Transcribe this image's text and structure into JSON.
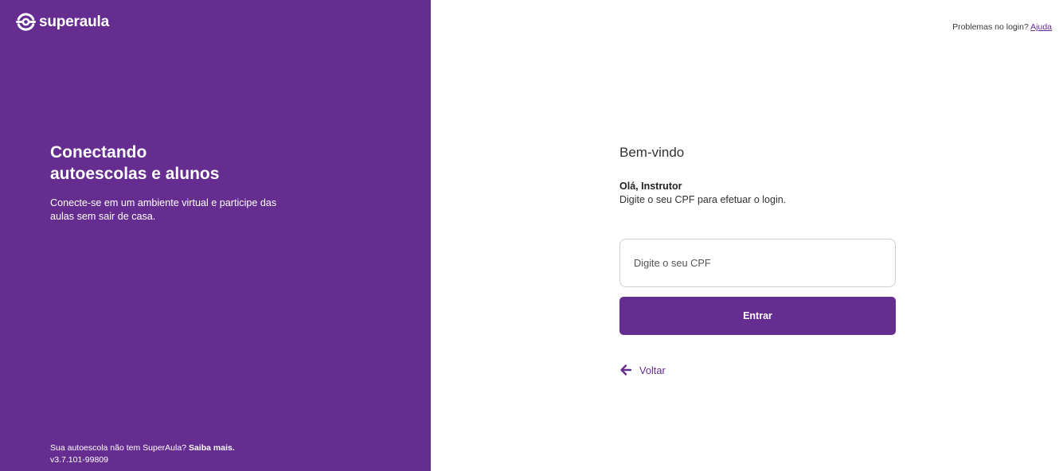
{
  "brand": {
    "name": "superaula",
    "logo_icon": "superaula-logo-icon",
    "primary_color": "#652d8f"
  },
  "left_panel": {
    "headline_line1": "Conectando",
    "headline_line2": "autoescolas e alunos",
    "description": "Conecte-se em um ambiente virtual e participe das aulas sem sair de casa.",
    "footer_text": "Sua autoescola não tem SuperAula?",
    "footer_link": "Saiba mais.",
    "version": "v3.7.101-99809"
  },
  "header": {
    "help_text": "Problemas no login?",
    "help_link": "Ajuda"
  },
  "login": {
    "title": "Bem-vindo",
    "greeting": "Olá, Instrutor",
    "instruction": "Digite o seu CPF para efetuar o login.",
    "cpf_placeholder": "Digite o seu CPF",
    "cpf_value": "",
    "submit_label": "Entrar",
    "back_label": "Voltar",
    "back_icon": "arrow-left-icon"
  }
}
